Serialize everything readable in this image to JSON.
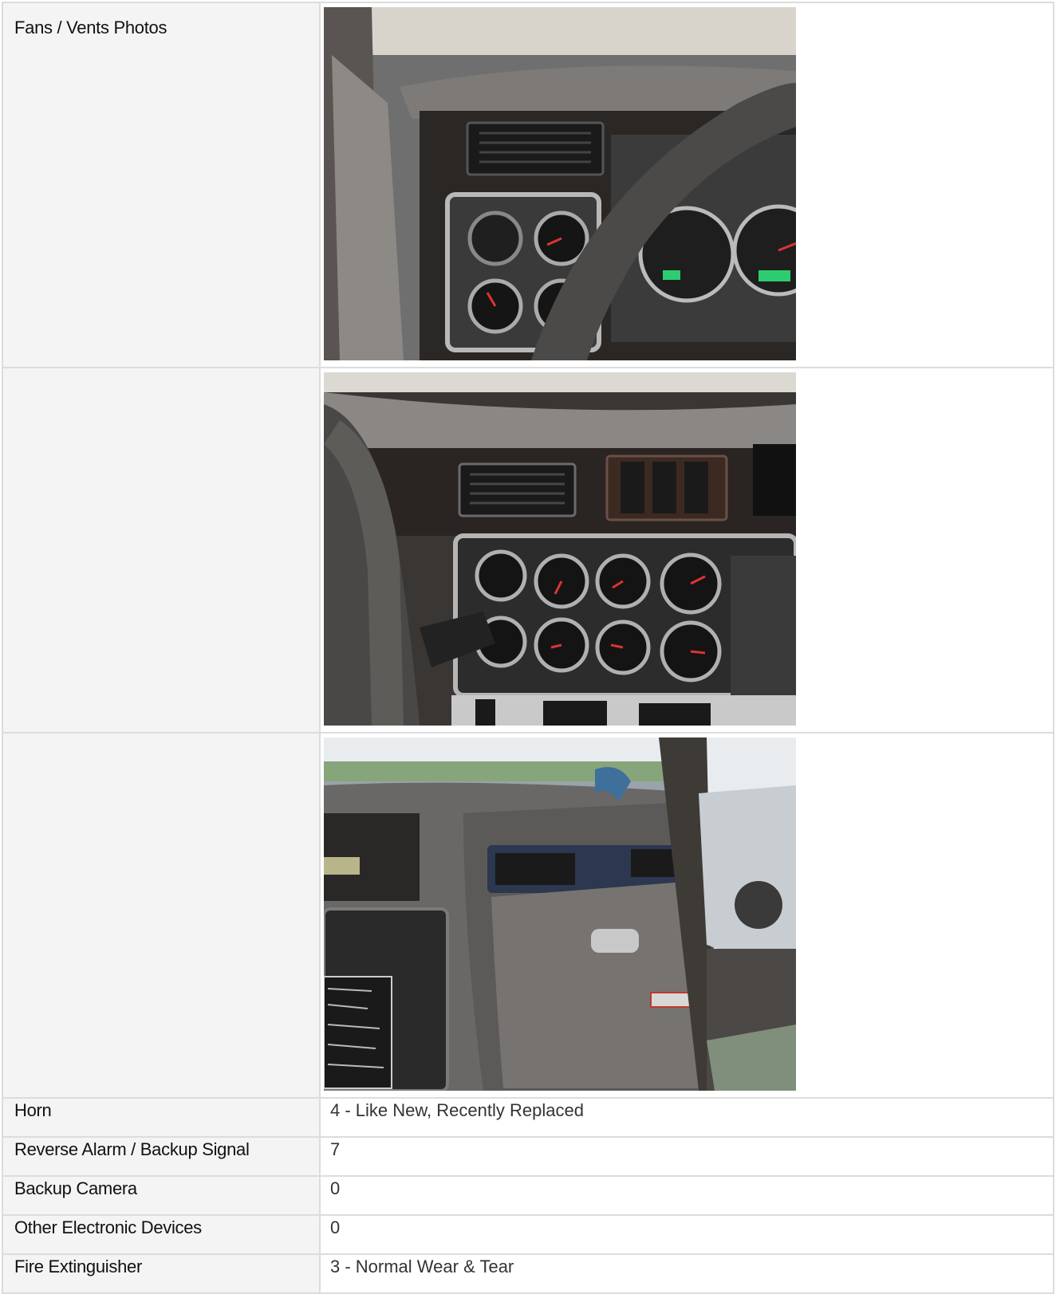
{
  "rows": [
    {
      "label": "Fans / Vents Photos",
      "photo": "dashboard-vent-gauges-photo"
    },
    {
      "label": "",
      "photo": "dashboard-center-gauges-photo"
    },
    {
      "label": "",
      "photo": "dashboard-passenger-glovebox-photo"
    },
    {
      "label": "Horn",
      "value": "4 - Like New, Recently Replaced"
    },
    {
      "label": "Reverse Alarm / Backup Signal",
      "value": "7"
    },
    {
      "label": "Backup Camera",
      "value": "0"
    },
    {
      "label": "Other Electronic Devices",
      "value": "0"
    },
    {
      "label": "Fire Extinguisher",
      "value": "3 - Normal Wear & Tear"
    }
  ],
  "colors": {
    "border": "#dcdcdc",
    "label_background": "#f4f4f4",
    "value_background": "#ffffff"
  }
}
